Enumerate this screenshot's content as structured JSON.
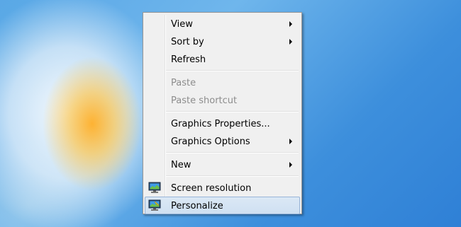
{
  "menu": {
    "items": [
      {
        "label": "View",
        "has_submenu": true,
        "enabled": true
      },
      {
        "label": "Sort by",
        "has_submenu": true,
        "enabled": true
      },
      {
        "label": "Refresh",
        "has_submenu": false,
        "enabled": true
      },
      {
        "label": "Paste",
        "has_submenu": false,
        "enabled": false
      },
      {
        "label": "Paste shortcut",
        "has_submenu": false,
        "enabled": false
      },
      {
        "label": "Graphics Properties...",
        "has_submenu": false,
        "enabled": true
      },
      {
        "label": "Graphics Options",
        "has_submenu": true,
        "enabled": true
      },
      {
        "label": "New",
        "has_submenu": true,
        "enabled": true
      },
      {
        "label": "Screen resolution",
        "icon": "monitor-icon",
        "enabled": true
      },
      {
        "label": "Personalize",
        "icon": "personalize-monitor-icon",
        "enabled": true,
        "highlighted": true
      }
    ]
  },
  "colors": {
    "highlight_bg": "#cfe0f2",
    "highlight_border": "#99b5d8",
    "disabled_text": "#8d8d8d",
    "menu_bg": "#f0f0f0"
  }
}
